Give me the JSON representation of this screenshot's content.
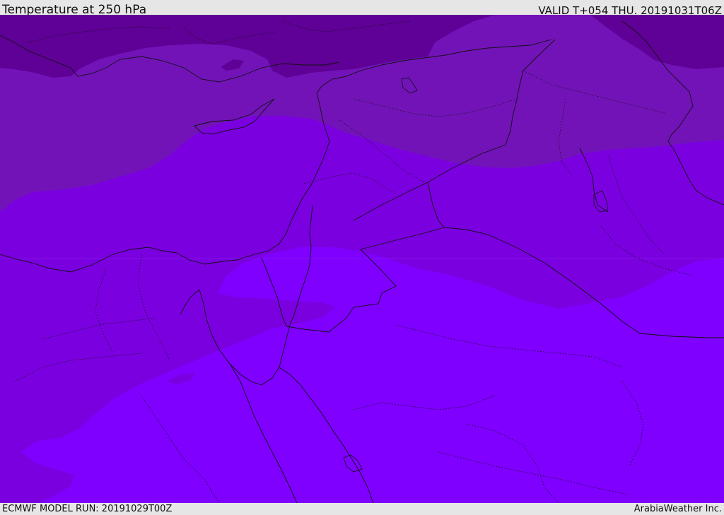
{
  "header": {
    "title": "Temperature at 250 hPa",
    "valid": "VALID T+054 THU. 20191031T06Z"
  },
  "footer": {
    "run": "ECMWF MODEL RUN: 20191029T00Z",
    "credit": "ArabiaWeather Inc."
  },
  "map": {
    "colors": {
      "band_darkest": "#5f0096",
      "band_dark": "#7213b8",
      "band_mid": "#7b00e0",
      "band_light": "#7f00ff",
      "borders": "#111111"
    }
  }
}
